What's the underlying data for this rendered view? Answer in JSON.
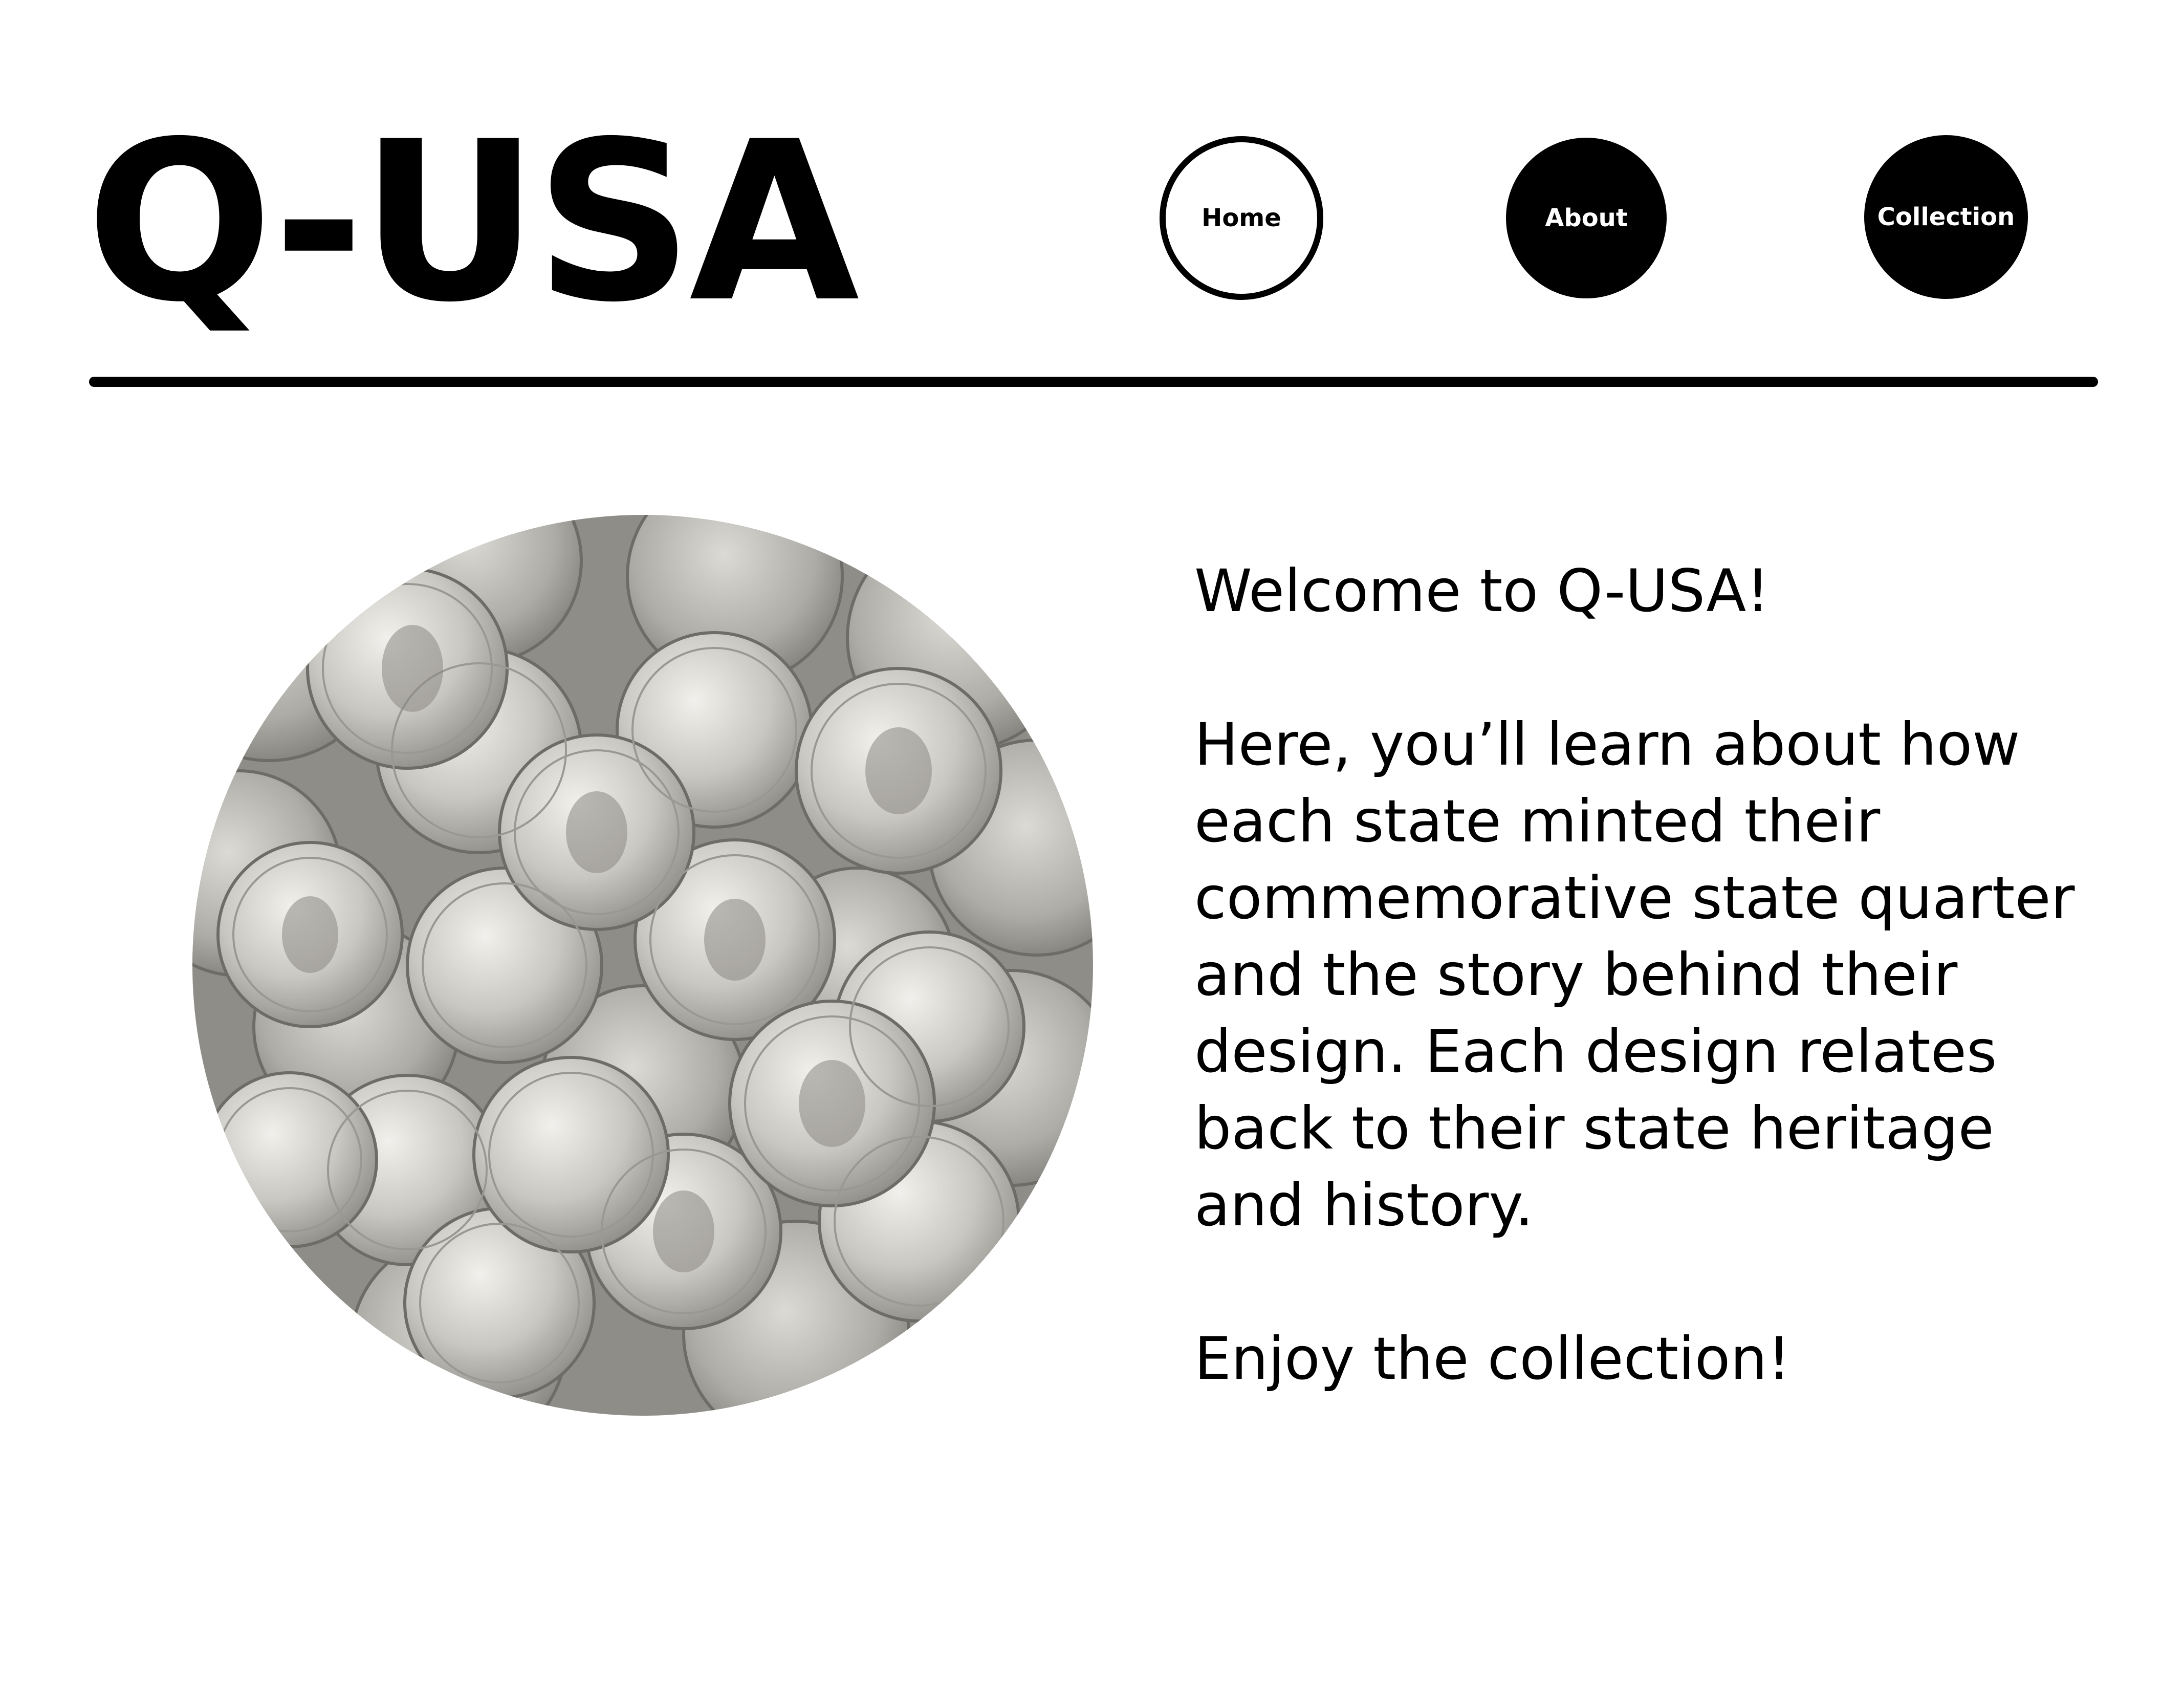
{
  "header": {
    "logo": "Q-USA",
    "nav": [
      {
        "label": "Home",
        "style": "outline"
      },
      {
        "label": "About",
        "style": "filled"
      },
      {
        "label": "Collection",
        "style": "filled"
      }
    ]
  },
  "main": {
    "image": {
      "icon": "coins-photo",
      "alt": "pile of quarters"
    },
    "welcome": "Welcome to Q-USA!",
    "body": "Here, you’ll learn about how each state minted their commemorative state quarter and the story behind their design. Each design relates back to their state heritage and history.",
    "closing": "Enjoy the collection!"
  },
  "colors": {
    "text": "#000000",
    "background": "#ffffff",
    "coin": "#c4c2bc"
  }
}
